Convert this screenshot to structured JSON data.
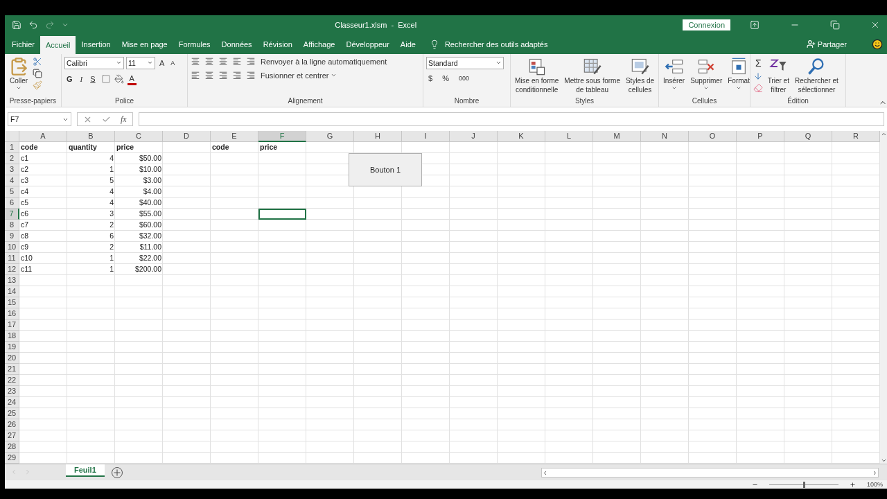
{
  "title_bar": {
    "title": "Classeur1.xlsm  -  Excel",
    "sign_in": "Connexion"
  },
  "menu_tabs": [
    {
      "label": "Fichier",
      "selected": false
    },
    {
      "label": "Accueil",
      "selected": true
    },
    {
      "label": "Insertion",
      "selected": false
    },
    {
      "label": "Mise en page",
      "selected": false
    },
    {
      "label": "Formules",
      "selected": false
    },
    {
      "label": "Données",
      "selected": false
    },
    {
      "label": "Révision",
      "selected": false
    },
    {
      "label": "Affichage",
      "selected": false
    },
    {
      "label": "Développeur",
      "selected": false
    },
    {
      "label": "Aide",
      "selected": false
    }
  ],
  "tell_me": "Rechercher des outils adaptés",
  "share": "Partager",
  "ribbon": {
    "clipboard": {
      "paste": "Coller",
      "label": "Presse-papiers"
    },
    "font": {
      "font_name": "Calibri",
      "font_size": "11",
      "grow": "A",
      "shrink": "A",
      "bold": "G",
      "italic": "I",
      "underline": "S",
      "font_color": "A",
      "label": "Police"
    },
    "alignment": {
      "wrap": "Renvoyer à la ligne automatiquement",
      "merge": "Fusionner et centrer",
      "label": "Alignement"
    },
    "number": {
      "format": "Standard",
      "currency": "$",
      "percent": "%",
      "thousands": "000",
      "label": "Nombre"
    },
    "styles": {
      "items": [
        {
          "kind": "conditional",
          "line1": "Mise en forme",
          "line2": "conditionnelle"
        },
        {
          "kind": "table",
          "line1": "Mettre sous forme",
          "line2": "de tableau"
        },
        {
          "kind": "cellstyle",
          "line1": "Styles de",
          "line2": "cellules"
        }
      ],
      "label": "Styles"
    },
    "cells": {
      "items": [
        {
          "kind": "insert",
          "line1": "Insérer"
        },
        {
          "kind": "delete",
          "line1": "Supprimer"
        },
        {
          "kind": "format",
          "line1": "Format"
        }
      ],
      "label": "Cellules"
    },
    "editing": {
      "sum": "Σ",
      "items": [
        {
          "kind": "sort",
          "line1": "Trier et",
          "line2": "filtrer"
        },
        {
          "kind": "find",
          "line1": "Rechercher et",
          "line2": "sélectionner"
        }
      ],
      "label": "Édition"
    }
  },
  "formula_bar": {
    "name_box": "F7",
    "fx": "fx"
  },
  "sheet": {
    "columns": [
      {
        "label": "A",
        "selected": false,
        "kind": "text",
        "cells": [
          "code",
          "c1",
          "c2",
          "c3",
          "c4",
          "c5",
          "c6",
          "c7",
          "c8",
          "c9",
          "c10",
          "c11"
        ]
      },
      {
        "label": "B",
        "selected": false,
        "kind": "number",
        "cells": [
          "quantity",
          "4",
          "1",
          "5",
          "4",
          "4",
          "3",
          "2",
          "6",
          "2",
          "1",
          "1"
        ]
      },
      {
        "label": "C",
        "selected": false,
        "kind": "number",
        "cells": [
          "price",
          "$50.00",
          "$10.00",
          "$3.00",
          "$4.00",
          "$40.00",
          "$55.00",
          "$60.00",
          "$32.00",
          "$11.00",
          "$22.00",
          "$200.00"
        ]
      },
      {
        "label": "D",
        "selected": false,
        "kind": "text"
      },
      {
        "label": "E",
        "selected": false,
        "kind": "text",
        "cells": [
          "code"
        ]
      },
      {
        "label": "F",
        "selected": true,
        "kind": "text",
        "cells": [
          "price"
        ]
      },
      {
        "label": "G",
        "selected": false,
        "kind": "text"
      },
      {
        "label": "H",
        "selected": false,
        "kind": "text"
      },
      {
        "label": "I",
        "selected": false,
        "kind": "text"
      },
      {
        "label": "J",
        "selected": false,
        "kind": "text"
      },
      {
        "label": "K",
        "selected": false,
        "kind": "text"
      },
      {
        "label": "L",
        "selected": false,
        "kind": "text"
      },
      {
        "label": "M",
        "selected": false,
        "kind": "text"
      },
      {
        "label": "N",
        "selected": false,
        "kind": "text"
      },
      {
        "label": "O",
        "selected": false,
        "kind": "text"
      },
      {
        "label": "P",
        "selected": false,
        "kind": "text"
      },
      {
        "label": "Q",
        "selected": false,
        "kind": "text"
      },
      {
        "label": "R",
        "selected": false,
        "kind": "text"
      }
    ],
    "rows": [
      {
        "label": "1",
        "selected": false
      },
      {
        "label": "2",
        "selected": false
      },
      {
        "label": "3",
        "selected": false
      },
      {
        "label": "4",
        "selected": false
      },
      {
        "label": "5",
        "selected": false
      },
      {
        "label": "6",
        "selected": false
      },
      {
        "label": "7",
        "selected": true
      },
      {
        "label": "8",
        "selected": false
      },
      {
        "label": "9",
        "selected": false
      },
      {
        "label": "10",
        "selected": false
      },
      {
        "label": "11",
        "selected": false
      },
      {
        "label": "12",
        "selected": false
      },
      {
        "label": "13",
        "selected": false
      },
      {
        "label": "14",
        "selected": false
      },
      {
        "label": "15",
        "selected": false
      },
      {
        "label": "16",
        "selected": false
      },
      {
        "label": "17",
        "selected": false
      },
      {
        "label": "18",
        "selected": false
      },
      {
        "label": "19",
        "selected": false
      },
      {
        "label": "20",
        "selected": false
      },
      {
        "label": "21",
        "selected": false
      },
      {
        "label": "22",
        "selected": false
      },
      {
        "label": "23",
        "selected": false
      },
      {
        "label": "24",
        "selected": false
      },
      {
        "label": "25",
        "selected": false
      },
      {
        "label": "26",
        "selected": false
      },
      {
        "label": "27",
        "selected": false
      },
      {
        "label": "28",
        "selected": false
      },
      {
        "label": "29",
        "selected": false
      }
    ],
    "form_button": "Bouton 1"
  },
  "sheet_tabs": [
    {
      "label": "Feuil1",
      "selected": true
    }
  ],
  "status_bar": {
    "zoom": "100%",
    "zoom_slider": {
      "level": 0.5
    }
  }
}
